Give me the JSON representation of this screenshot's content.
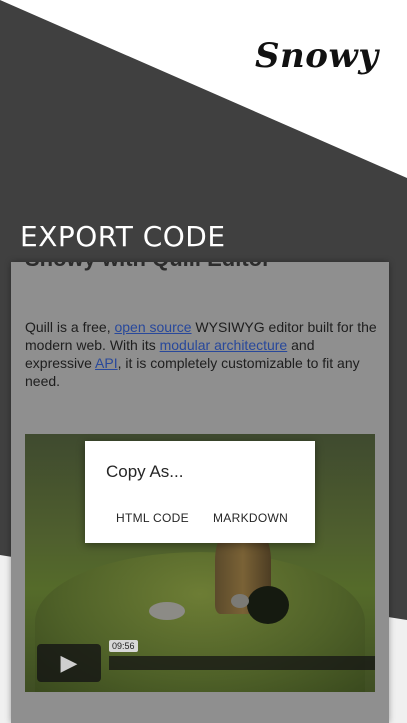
{
  "brand": "Snowy",
  "headline": "EXPORT CODE",
  "document": {
    "title": "Snowy with Quill Editor",
    "text_1": "Quill is a free, ",
    "link_1": "open source",
    "text_2": " WYSIWYG editor built for the modern web. With its ",
    "link_2": "modular architecture",
    "text_3": " and expressive ",
    "link_3": "API",
    "text_4": ", it is completely customizable to fit any need."
  },
  "video": {
    "play_icon": "▶",
    "timestamp": "09:56"
  },
  "dialog": {
    "title": "Copy As...",
    "html_button": "HTML CODE",
    "markdown_button": "MARKDOWN"
  }
}
